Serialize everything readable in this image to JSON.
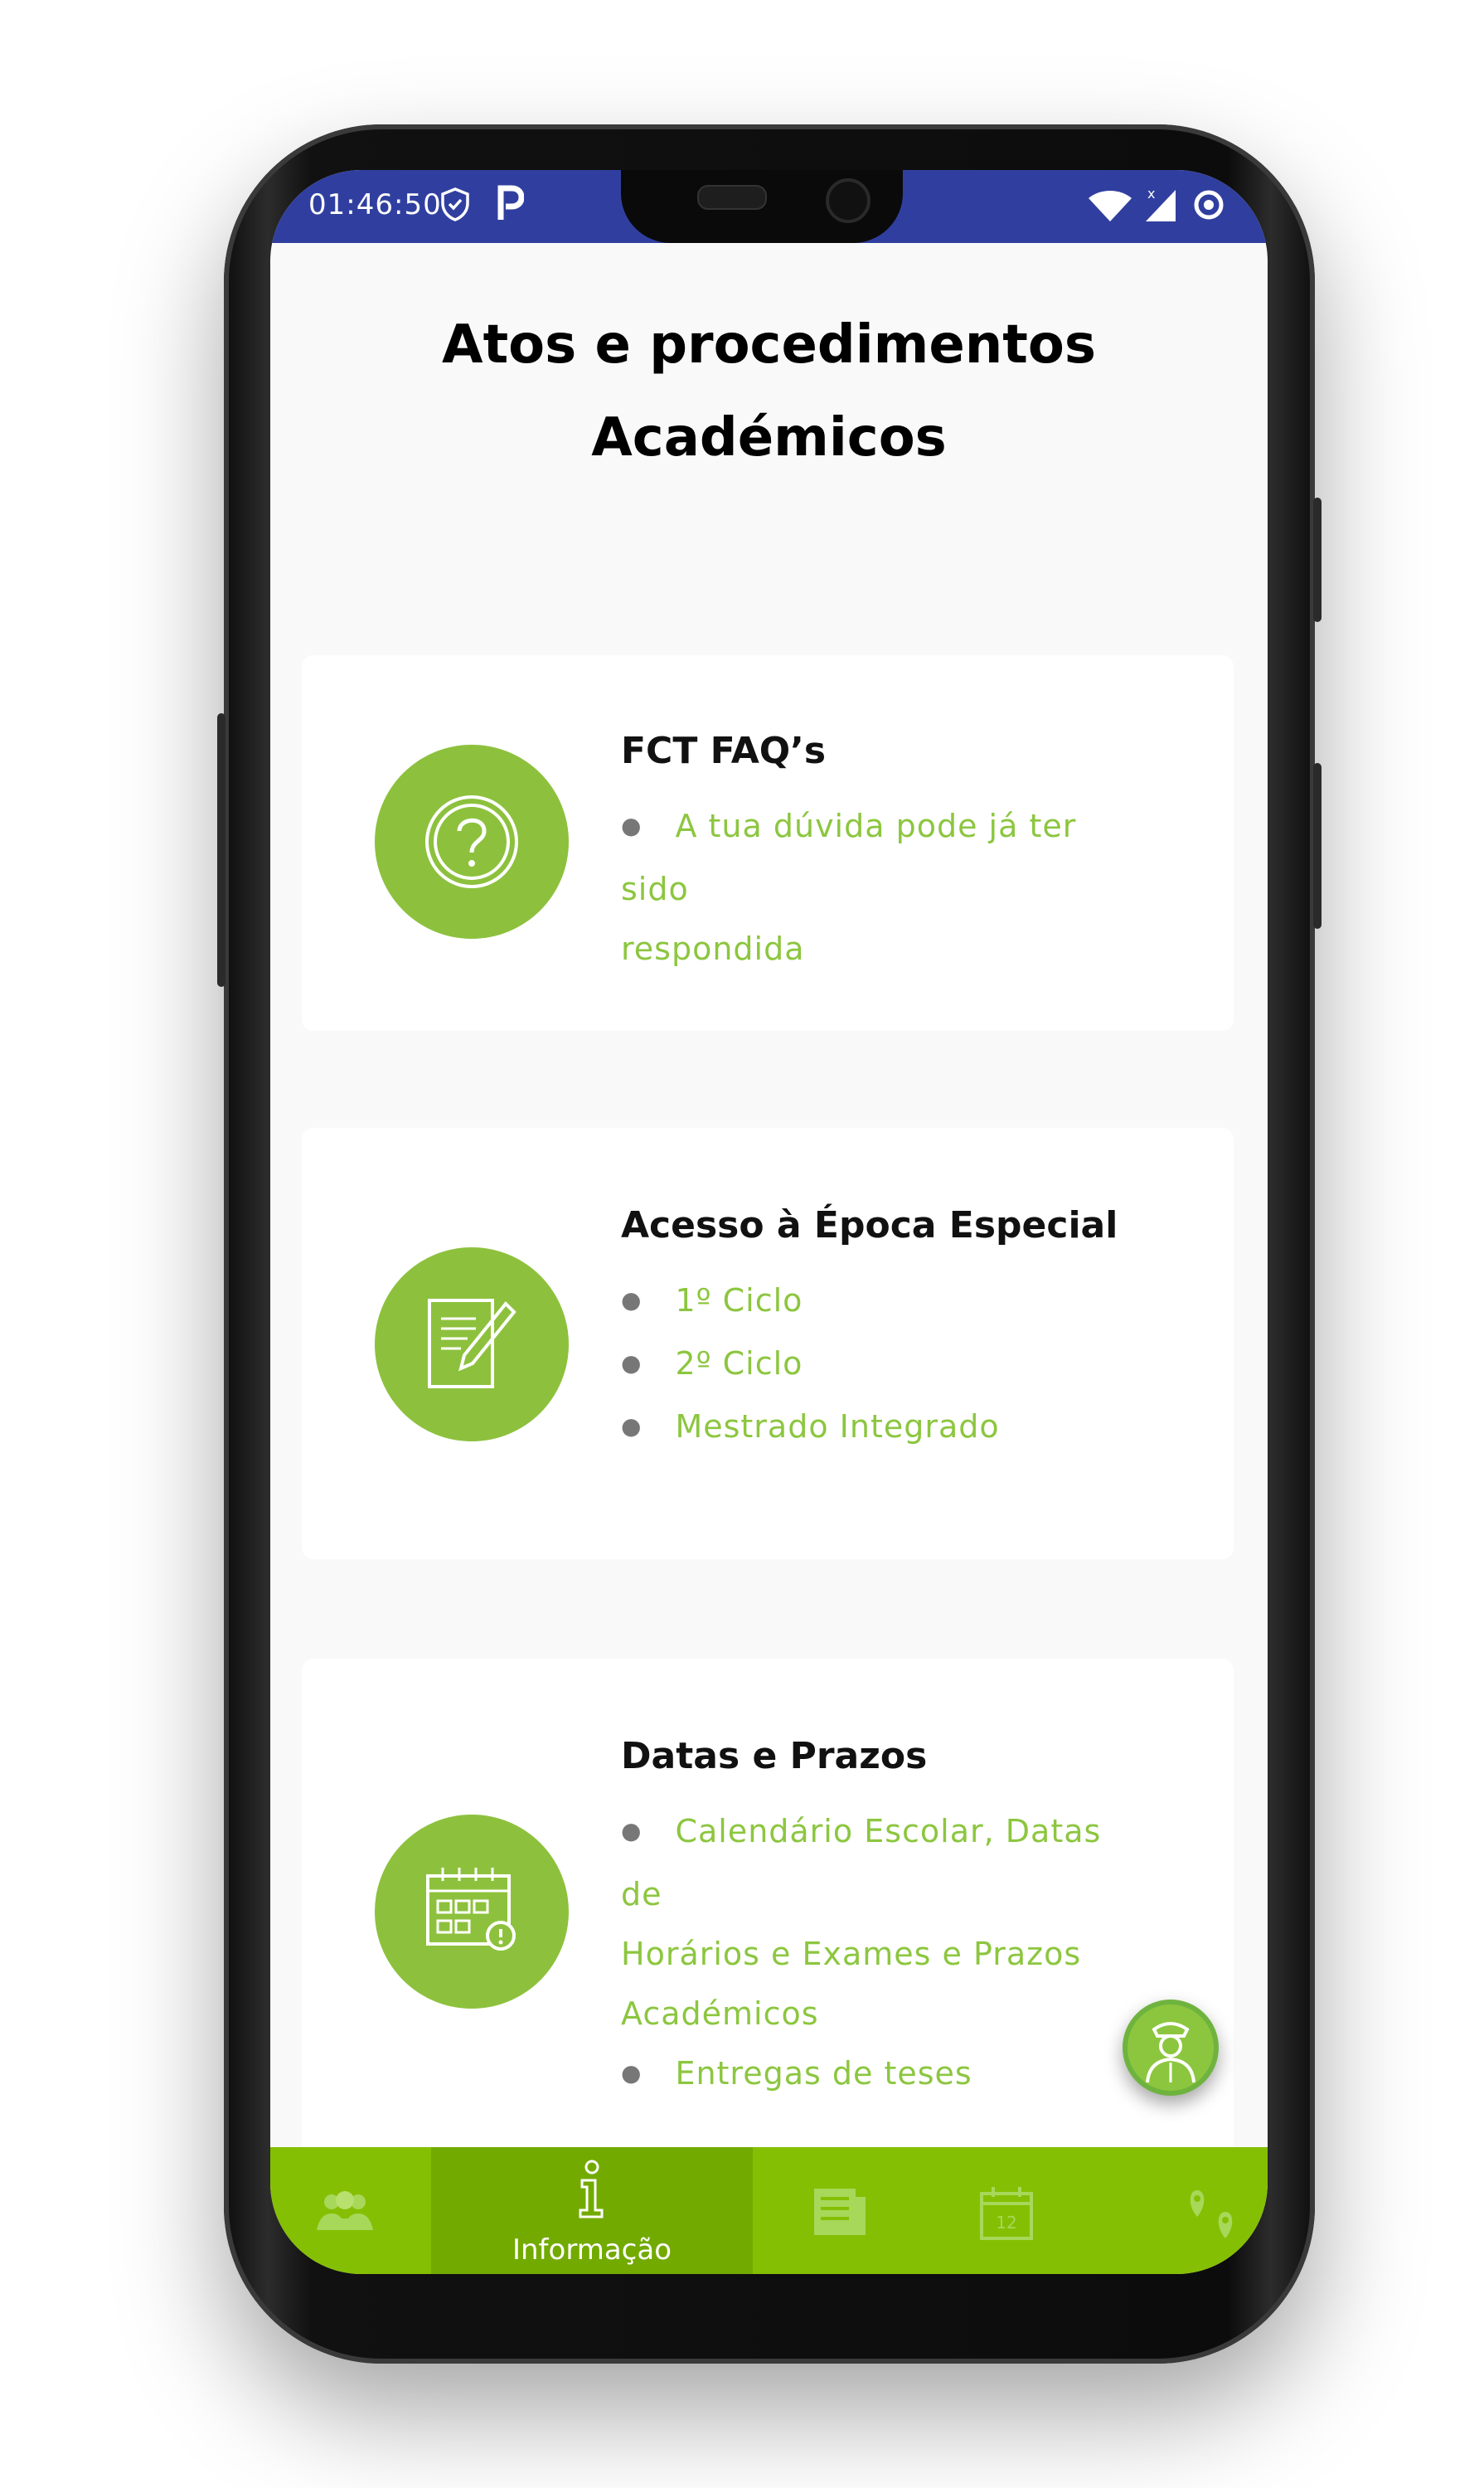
{
  "status_bar": {
    "time": "01:46:50"
  },
  "page": {
    "title_line1": "Atos e procedimentos",
    "title_line2": "Académicos"
  },
  "cards": [
    {
      "title": "FCT FAQ’s",
      "icon": "question-icon",
      "items": [
        "A tua dúvida pode já ter sido",
        "respondida"
      ]
    },
    {
      "title": "Acesso à Época Especial",
      "icon": "document-edit-icon",
      "items": [
        "1º Ciclo",
        "2º Ciclo",
        "Mestrado Integrado"
      ]
    },
    {
      "title": "Datas e Prazos",
      "icon": "calendar-alert-icon",
      "items": [
        "Calendário Escolar, Datas de",
        "Horários e Exames e Prazos",
        "Académicos",
        "Entregas de teses"
      ]
    }
  ],
  "bottom_nav": {
    "items": [
      {
        "icon": "people-icon",
        "label": ""
      },
      {
        "icon": "info-icon",
        "label": "Informação"
      },
      {
        "icon": "newspaper-icon",
        "label": ""
      },
      {
        "icon": "calendar-icon",
        "label": ""
      },
      {
        "icon": "map-pins-icon",
        "label": ""
      }
    ],
    "active_index": 1
  },
  "colors": {
    "status_bar": "#303f9f",
    "accent_green": "#8cc63f",
    "nav_green": "#85bf03",
    "nav_active": "#72aa00"
  }
}
